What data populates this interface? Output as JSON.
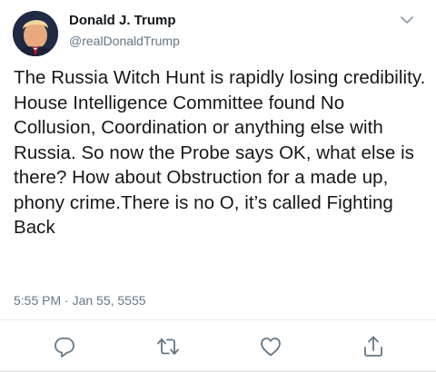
{
  "author": {
    "name": "Donald J. Trump",
    "handle": "@realDonaldTrump"
  },
  "tweet": {
    "text": "The Russia Witch Hunt is rapidly losing credibility. House Intelligence Committee found No Collusion, Coordination or anything else with Russia. So now the Probe says OK, what else is there? How about Obstruction for a made up, phony crime.There is no O, it’s called Fighting Back",
    "timestamp": "5:55 PM · Jan 55, 5555"
  },
  "actions": {
    "reply_icon": "reply-icon",
    "retweet_icon": "retweet-icon",
    "like_icon": "heart-icon",
    "share_icon": "share-icon"
  },
  "colors": {
    "text": "#14171a",
    "secondary": "#657786",
    "divider": "#e6ecf0"
  }
}
